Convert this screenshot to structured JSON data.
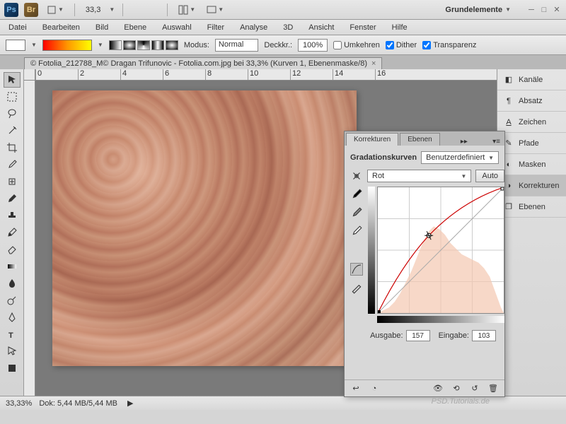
{
  "topbar": {
    "zoom": "33,3",
    "workspace": "Grundelemente"
  },
  "menu": [
    "Datei",
    "Bearbeiten",
    "Bild",
    "Ebene",
    "Auswahl",
    "Filter",
    "Analyse",
    "3D",
    "Ansicht",
    "Fenster",
    "Hilfe"
  ],
  "options": {
    "modus_label": "Modus:",
    "modus_value": "Normal",
    "deckr_label": "Deckkr.:",
    "deckr_value": "100%",
    "umkehren": "Umkehren",
    "dither": "Dither",
    "transparenz": "Transparenz"
  },
  "doc_tab": "© Fotolia_212788_M© Dragan Trifunovic - Fotolia.com.jpg bei 33,3% (Kurven 1, Ebenenmaske/8)",
  "ruler": [
    "0",
    "2",
    "4",
    "6",
    "8",
    "10",
    "12",
    "14",
    "16"
  ],
  "right_panels": [
    "Kanäle",
    "Absatz",
    "Zeichen",
    "Pfade",
    "Masken",
    "Korrekturen",
    "Ebenen"
  ],
  "korrek": {
    "tab1": "Korrekturen",
    "tab2": "Ebenen",
    "title": "Gradationskurven",
    "preset": "Benutzerdefiniert",
    "channel": "Rot",
    "auto": "Auto",
    "ausgabe_label": "Ausgabe:",
    "ausgabe_value": "157",
    "eingabe_label": "Eingabe:",
    "eingabe_value": "103"
  },
  "status": {
    "zoom": "33,33%",
    "dok": "Dok: 5,44 MB/5,44 MB"
  },
  "watermark": "PSD.Tutorials.de",
  "chart_data": {
    "type": "line",
    "title": "Gradationskurven – Rot",
    "xlabel": "Eingabe",
    "ylabel": "Ausgabe",
    "xlim": [
      0,
      255
    ],
    "ylim": [
      0,
      255
    ],
    "curve_points": [
      [
        0,
        0
      ],
      [
        50,
        100
      ],
      [
        103,
        157
      ],
      [
        160,
        210
      ],
      [
        220,
        245
      ],
      [
        255,
        255
      ]
    ],
    "selected_point": {
      "eingabe": 103,
      "ausgabe": 157
    },
    "histogram_approx": [
      0,
      2,
      4,
      8,
      14,
      22,
      30,
      40,
      50,
      58,
      62,
      60,
      56,
      50,
      46,
      42,
      40,
      38,
      36,
      34,
      32,
      30,
      26,
      20,
      12,
      6,
      2,
      0
    ]
  }
}
